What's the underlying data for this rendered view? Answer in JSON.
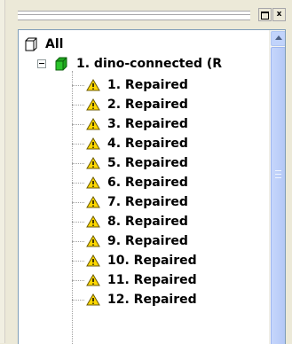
{
  "titlebar": {
    "restore_label": "□",
    "close_label": "x"
  },
  "icons": {
    "root": "folder-outline-icon",
    "group": "green-folder-icon",
    "item": "warning-triangle-icon",
    "expander": "collapse-minus-icon"
  },
  "colors": {
    "panel_border": "#7f9db9",
    "warning_fill": "#ffd800",
    "group_icon": "#1ea51e",
    "scrollbar_thumb": "#c1d3fb"
  },
  "tree": {
    "root_label": "All",
    "group_label": "1. dino-connected (R",
    "children": [
      "1. Repaired",
      "2. Repaired",
      "3. Repaired",
      "4. Repaired",
      "5. Repaired",
      "6. Repaired",
      "7. Repaired",
      "8. Repaired",
      "9. Repaired",
      "10. Repaired",
      "11. Repaired",
      "12. Repaired"
    ]
  }
}
